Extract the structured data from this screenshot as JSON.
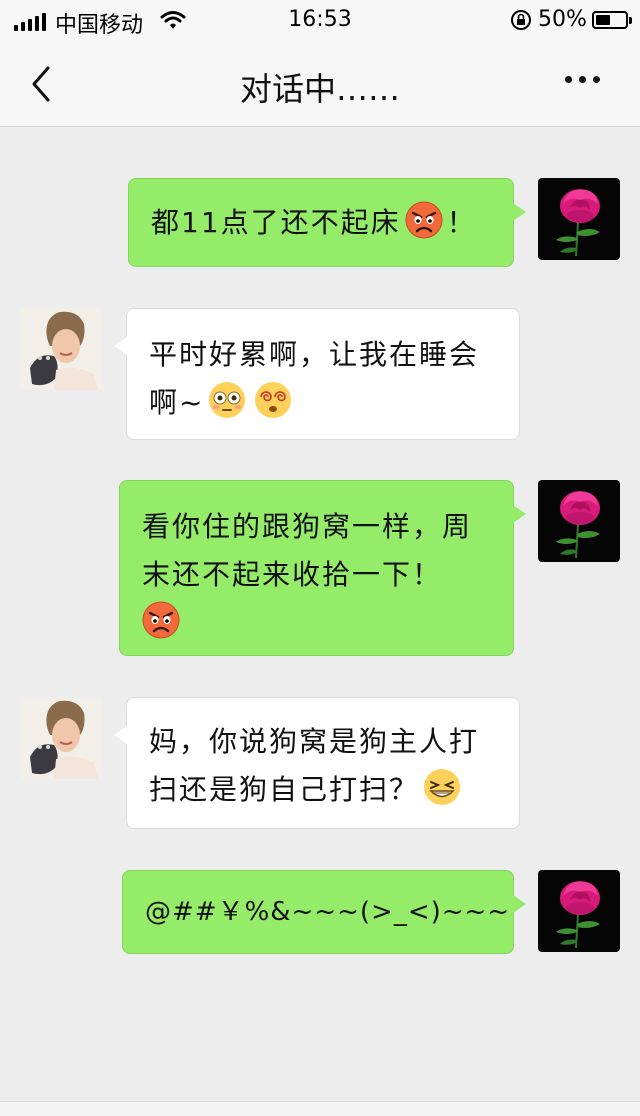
{
  "status_bar": {
    "carrier": "中国移动",
    "time": "16:53",
    "battery_percent": "50%",
    "battery_level": 0.5,
    "icons": [
      "signal-icon",
      "wifi-icon",
      "orientation-lock-icon",
      "battery-icon"
    ]
  },
  "nav": {
    "title": "对话中……",
    "back_icon": "chevron-left-icon",
    "more_icon": "more-dots-icon"
  },
  "colors": {
    "outgoing_bubble": "#95ec69",
    "incoming_bubble": "#ffffff",
    "background": "#ededed"
  },
  "messages": [
    {
      "side": "outgoing",
      "text_before": "都11点了还不起床",
      "emoji": "angry-face-icon",
      "text_after": "！"
    },
    {
      "side": "incoming",
      "text_lines": [
        "平时好累啊，让我在睡会",
        "啊~"
      ],
      "emojis": [
        "flushed-face-icon",
        "dizzy-face-icon"
      ]
    },
    {
      "side": "outgoing",
      "text_lines": [
        "看你住的跟狗窝一样，周",
        "末还不起来收拾一下！"
      ],
      "emoji": "angry-face-icon"
    },
    {
      "side": "incoming",
      "text_lines": [
        "妈，你说狗窝是狗主人打",
        "扫还是狗自己打扫？"
      ],
      "emoji": "grinning-squint-face-icon"
    },
    {
      "side": "outgoing",
      "text": "@##￥%&~~~(>_<)~~~"
    }
  ]
}
